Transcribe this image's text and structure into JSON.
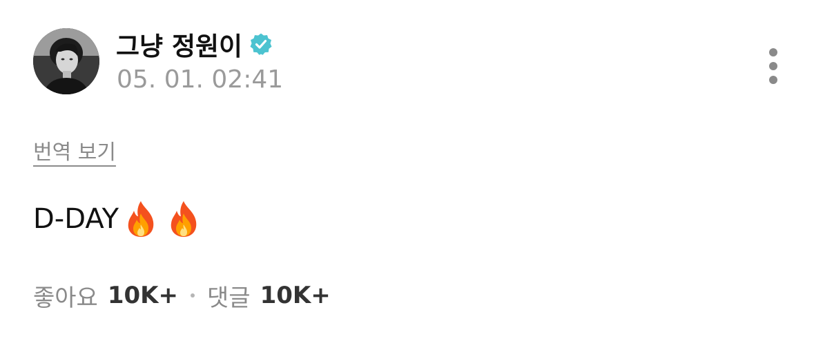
{
  "post": {
    "author": {
      "name": "그냥 정원이",
      "verified": true,
      "verified_icon": "verified-badge-icon",
      "avatar_icon": "avatar-photo"
    },
    "timestamp": "05. 01. 02:41",
    "more_icon": "more-vertical-icon",
    "translate_label": "번역 보기",
    "body": {
      "text": "D-DAY",
      "emoji": [
        "fire-icon",
        "fire-icon"
      ]
    },
    "stats": {
      "likes_label": "좋아요",
      "likes_value": "10K+",
      "comments_label": "댓글",
      "comments_value": "10K+"
    }
  },
  "colors": {
    "text_primary": "#111111",
    "text_secondary": "#9a9a9a",
    "verified": "#4cc3d0",
    "background": "#ffffff"
  }
}
